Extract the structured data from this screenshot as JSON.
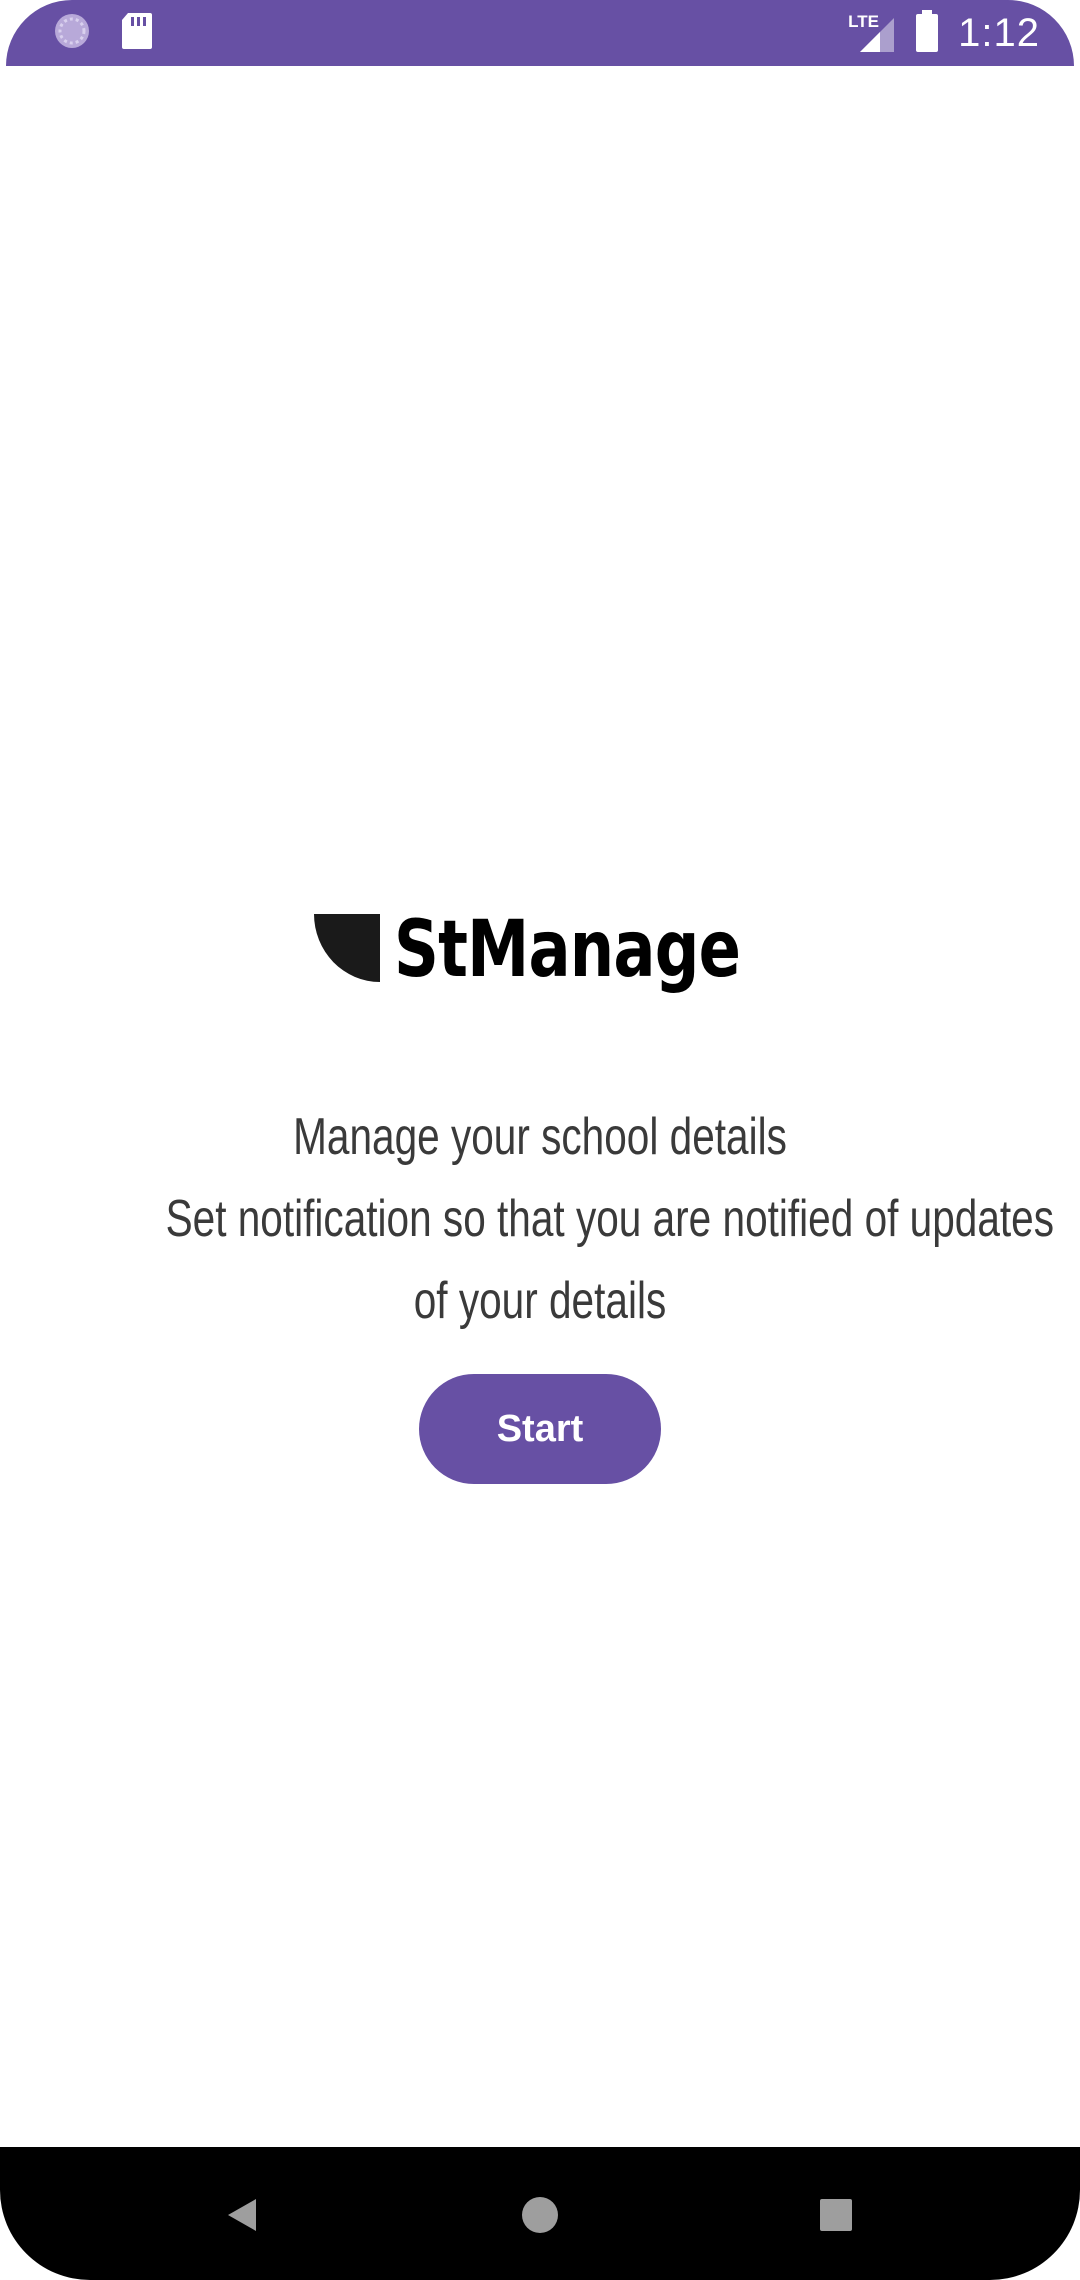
{
  "status_bar": {
    "time": "1:12",
    "network": "LTE",
    "color": "#6750a4",
    "icons": [
      "sync-icon",
      "sd-card-icon",
      "lte-signal-icon",
      "battery-icon"
    ]
  },
  "app": {
    "name": "StManage",
    "logo_icon": "quarter-circle-logo-icon"
  },
  "tagline": {
    "line1": "Manage your school details",
    "line2": "Set notification so that you are notified of updates",
    "line3": "of your details"
  },
  "start_button": {
    "label": "Start",
    "color": "#6750a4"
  },
  "nav_bar": {
    "icons": [
      "back-icon",
      "home-icon",
      "recents-icon"
    ]
  }
}
